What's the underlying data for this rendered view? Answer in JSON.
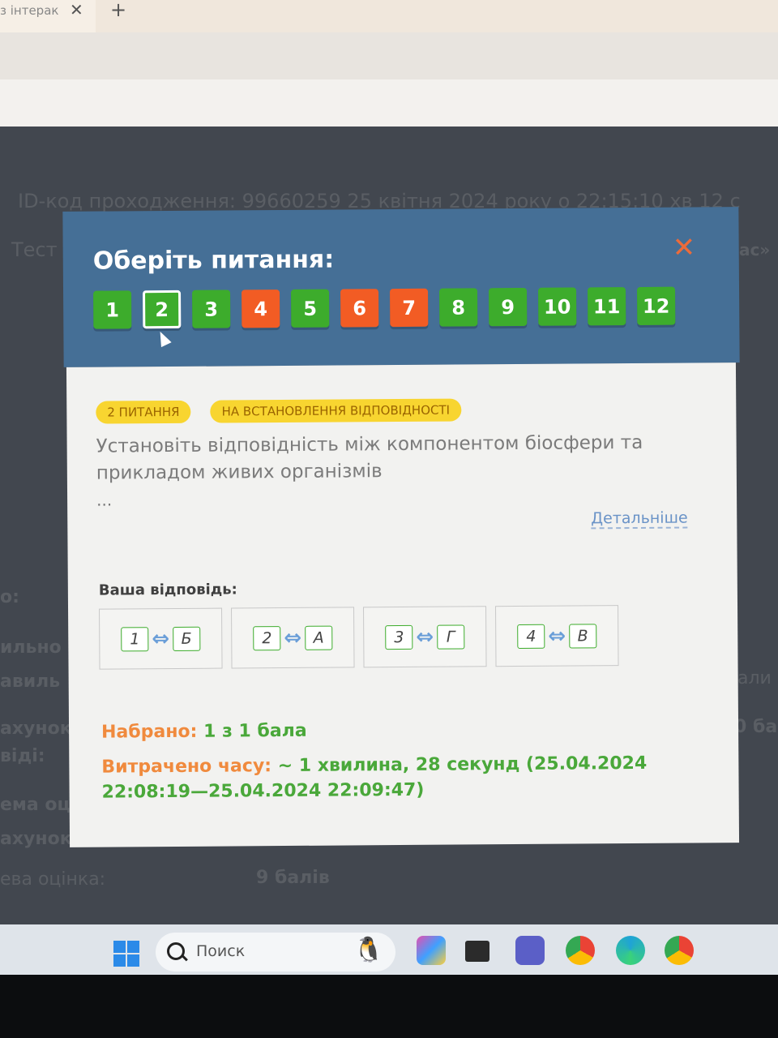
{
  "browser": {
    "tab_title": "з інтерак",
    "tab_close": "✕",
    "new_tab": "+"
  },
  "page": {
    "id_line": "ID-код проходження: 99660259    25 квітня 2024 року о 22:15:10 хв 12 с",
    "test_label": "Тест",
    "right_fragment": "ас»",
    "left_fragments": [
      "о:",
      "ильно",
      "авиль",
      "ахунок",
      "віді:",
      "ема оц",
      "ахунок"
    ],
    "right_fragments": [
      "али",
      "0 ба"
    ],
    "final_label": "ева оцінка:",
    "final_value": "9 балів"
  },
  "modal": {
    "title": "Оберіть питання:",
    "close_label": "✕",
    "questions": [
      {
        "num": "1",
        "status": "correct"
      },
      {
        "num": "2",
        "status": "correct",
        "current": true
      },
      {
        "num": "3",
        "status": "correct"
      },
      {
        "num": "4",
        "status": "wrong"
      },
      {
        "num": "5",
        "status": "correct"
      },
      {
        "num": "6",
        "status": "wrong"
      },
      {
        "num": "7",
        "status": "wrong"
      },
      {
        "num": "8",
        "status": "correct"
      },
      {
        "num": "9",
        "status": "correct"
      },
      {
        "num": "10",
        "status": "correct"
      },
      {
        "num": "11",
        "status": "correct"
      },
      {
        "num": "12",
        "status": "correct"
      }
    ],
    "badge_number": "2 ПИТАННЯ",
    "badge_type": "НА ВСТАНОВЛЕННЯ ВІДПОВІДНОСТІ",
    "question_text": "Установіть відповідність між компонентом біосфери та прикладом живих організмів",
    "ellipsis": "...",
    "details_link": "Детальніше",
    "answer_label": "Ваша відповідь:",
    "pairs": [
      {
        "left": "1",
        "arrow": "⇔",
        "right": "Б"
      },
      {
        "left": "2",
        "arrow": "⇔",
        "right": "А"
      },
      {
        "left": "3",
        "arrow": "⇔",
        "right": "Г"
      },
      {
        "left": "4",
        "arrow": "⇔",
        "right": "В"
      }
    ],
    "score_label": "Набрано:",
    "score_value": "1 з 1 бала",
    "time_label": "Витрачено часу:",
    "time_value": "~ 1 хвилина, 28 секунд (25.04.2024 22:08:19—25.04.2024 22:09:47)"
  },
  "colors": {
    "header": "#456f96",
    "correct": "#3dac2c",
    "wrong": "#f25c24",
    "badge": "#f8d530"
  },
  "taskbar": {
    "search_placeholder": "Поиск",
    "apps": [
      "windows-start-icon",
      "copilot-icon",
      "file-explorer-icon",
      "teams-icon",
      "chrome-profile-icon",
      "edge-icon",
      "chrome-icon"
    ]
  }
}
